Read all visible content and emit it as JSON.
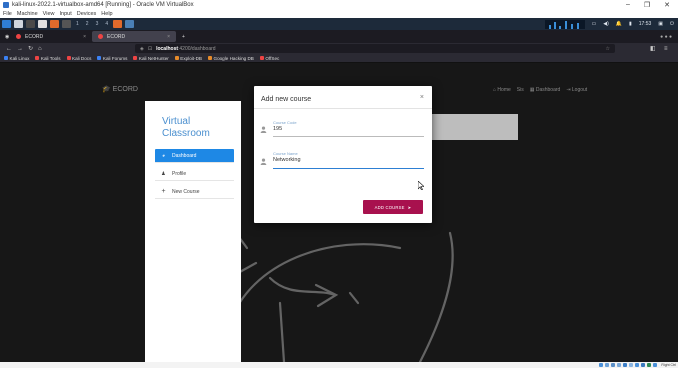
{
  "vbox": {
    "title": "kali-linux-2022.1-virtualbox-amd64 [Running] - Oracle VM VirtualBox",
    "menu": [
      "File",
      "Machine",
      "View",
      "Input",
      "Devices",
      "Help"
    ],
    "min": "–",
    "max": "❐",
    "close": "✕",
    "hostkey": "Right Ctrl"
  },
  "kali_panel": {
    "workspaces": [
      "1",
      "2",
      "3",
      "4"
    ],
    "time": "17:53"
  },
  "browser": {
    "tabs": [
      {
        "label": "ECORD"
      },
      {
        "label": "ECORD"
      }
    ],
    "new_tab": "+",
    "url_host": "localhost",
    "url_rest": ":4200/dashboard",
    "bookmarks": [
      "Kali Linux",
      "Kali Tools",
      "Kali Docs",
      "Kali Forums",
      "Kali NetHunter",
      "Exploit-DB",
      "Google Hacking DB",
      "OffSec"
    ]
  },
  "site": {
    "brand": "ECORD",
    "nav": [
      "Home",
      "Sis",
      "Dashboard",
      "Logout"
    ]
  },
  "sidebar": {
    "title_line1": "Virtual",
    "title_line2": "Classroom",
    "items": [
      {
        "label": "Dashboard",
        "active": true
      },
      {
        "label": "Profile",
        "active": false
      },
      {
        "label": "New Course",
        "active": false
      }
    ]
  },
  "modal": {
    "title": "Add new course",
    "close": "×",
    "course_code_label": "Course Code",
    "course_code_value": "195",
    "course_name_label": "Course Name",
    "course_name_value": "Networking",
    "submit_label": "ADD COURSE"
  },
  "colors": {
    "accent_blue": "#1e88e5",
    "submit": "#a8114e",
    "title_blue": "#4a8fcf"
  }
}
